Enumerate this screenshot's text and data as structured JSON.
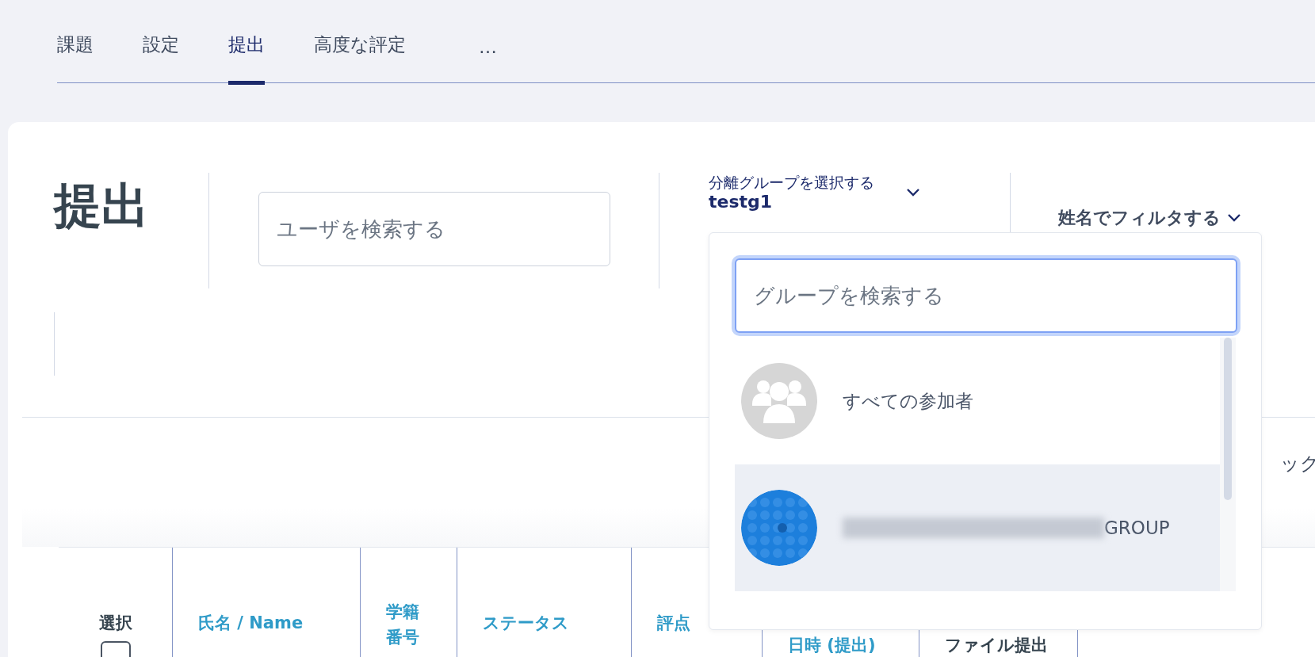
{
  "tabs": [
    {
      "label": "課題",
      "selected": false
    },
    {
      "label": "設定",
      "selected": false
    },
    {
      "label": "提出",
      "selected": true
    },
    {
      "label": "高度な評定",
      "selected": false
    },
    {
      "label": "…",
      "selected": false
    }
  ],
  "heading": "提出",
  "user_search": {
    "placeholder": "ユーザを検索する"
  },
  "group_selector": {
    "label": "分離グループを選択する",
    "value": "testg1",
    "expanded": true
  },
  "name_filter": {
    "label": "姓名でフィルタする"
  },
  "column_right_text": "ック",
  "group_dropdown": {
    "search": {
      "placeholder": "グループを検索する"
    },
    "items": [
      {
        "kind": "all",
        "label": "すべての参加者",
        "selected": false
      },
      {
        "kind": "group",
        "label": "GROUP",
        "selected": true
      }
    ]
  },
  "table": {
    "columns": [
      {
        "label": "選択",
        "kind": "plain"
      },
      {
        "label": "氏名 / **Name**",
        "kind": "link"
      },
      {
        "label": "学籍番号",
        "kind": "link"
      },
      {
        "label": "ステータス",
        "kind": "link"
      },
      {
        "label": "評点",
        "kind": "link"
      },
      {
        "label": "日時 (提出)",
        "kind": "link"
      },
      {
        "label": "ファイル提出",
        "kind": "plain"
      }
    ],
    "select_all_checked": false
  }
}
